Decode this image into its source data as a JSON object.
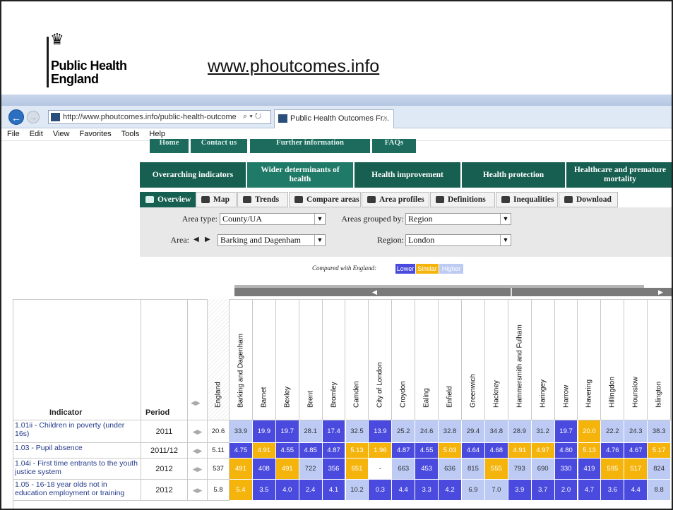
{
  "slide": {
    "org_name": "Public Health England",
    "org_line1": "Public Health",
    "org_line2": "England",
    "link_text": "www.phoutcomes.info"
  },
  "browser": {
    "address": "http://www.phoutcomes.info/public-health-outcome",
    "tab_title": "Public Health Outcomes Fr...",
    "menu": [
      "File",
      "Edit",
      "View",
      "Favorites",
      "Tools",
      "Help"
    ]
  },
  "site": {
    "top_tabs": [
      "Home",
      "Contact us",
      "Further information",
      "FAQs"
    ],
    "domains": [
      "Overarching indicators",
      "Wider determinants of health",
      "Health improvement",
      "Health protection",
      "Healthcare and premature mortality"
    ],
    "active_domain": "Wider determinants of health",
    "views": [
      "Overview",
      "Map",
      "Trends",
      "Compare areas",
      "Area profiles",
      "Definitions",
      "Inequalities",
      "Download"
    ],
    "active_view": "Overview"
  },
  "filters": {
    "area_type_label": "Area type:",
    "area_type_value": "County/UA",
    "grouped_label": "Areas grouped by:",
    "grouped_value": "Region",
    "area_label": "Area:",
    "area_value": "Barking and Dagenham",
    "region_label": "Region:",
    "region_value": "London"
  },
  "legend": {
    "caption": "Compared with England:",
    "lower": "Lower",
    "similar": "Similar",
    "higher": "Higher",
    "colors": {
      "lower": "#4a4adf",
      "similar": "#f5b40c",
      "higher": "#bccaf4"
    }
  },
  "table": {
    "indicator_header": "Indicator",
    "period_header": "Period",
    "england_header": "England",
    "areas": [
      "Barking and Dagenham",
      "Barnet",
      "Bexley",
      "Brent",
      "Bromley",
      "Camden",
      "City of London",
      "Croydon",
      "Ealing",
      "Enfield",
      "Greenwich",
      "Hackney",
      "Hammersmith and Fulham",
      "Haringey",
      "Harrow",
      "Havering",
      "Hillingdon",
      "Hounslow",
      "Islington"
    ],
    "rows": [
      {
        "indicator": "1.01ii - Children in poverty (under 16s)",
        "period": "2011",
        "england": "20.6",
        "values": [
          "33.9",
          "19.9",
          "19.7",
          "28.1",
          "17.4",
          "32.5",
          "13.9",
          "25.2",
          "24.6",
          "32.8",
          "29.4",
          "34.8",
          "28.9",
          "31.2",
          "19.7",
          "20.0",
          "22.2",
          "24.3",
          "38.3"
        ],
        "status": [
          "higher",
          "lower",
          "lower",
          "higher",
          "lower",
          "higher",
          "lower",
          "higher",
          "higher",
          "higher",
          "higher",
          "higher",
          "higher",
          "higher",
          "lower",
          "similar",
          "higher",
          "higher",
          "higher"
        ]
      },
      {
        "indicator": "1.03 - Pupil absence",
        "period": "2011/12",
        "england": "5.11",
        "values": [
          "4.75",
          "4.91",
          "4.55",
          "4.85",
          "4.87",
          "5.13",
          "1.96",
          "4.87",
          "4.55",
          "5.03",
          "4.64",
          "4.68",
          "4.91",
          "4.97",
          "4.80",
          "5.13",
          "4.76",
          "4.67",
          "5.17"
        ],
        "status": [
          "lower",
          "similar",
          "lower",
          "lower",
          "lower",
          "similar",
          "similar",
          "lower",
          "lower",
          "similar",
          "lower",
          "lower",
          "similar",
          "similar",
          "lower",
          "similar",
          "lower",
          "lower",
          "similar"
        ]
      },
      {
        "indicator": "1.04i - First time entrants to the youth justice system",
        "period": "2012",
        "england": "537",
        "values": [
          "491",
          "408",
          "491",
          "722",
          "356",
          "651",
          "-",
          "663",
          "453",
          "636",
          "815",
          "555",
          "793",
          "690",
          "330",
          "419",
          "595",
          "517",
          "824"
        ],
        "status": [
          "similar",
          "lower",
          "similar",
          "higher",
          "lower",
          "similar",
          "none",
          "higher",
          "lower",
          "higher",
          "higher",
          "similar",
          "higher",
          "higher",
          "lower",
          "lower",
          "similar",
          "similar",
          "higher"
        ]
      },
      {
        "indicator": "1.05 - 16-18 year olds not in education employment or training",
        "period": "2012",
        "england": "5.8",
        "values": [
          "5.4",
          "3.5",
          "4.0",
          "2.4",
          "4.1",
          "10.2",
          "0.3",
          "4.4",
          "3.3",
          "4.2",
          "6.9",
          "7.0",
          "3.9",
          "3.7",
          "2.0",
          "4.7",
          "3.6",
          "4.4",
          "8.8"
        ],
        "status": [
          "similar",
          "lower",
          "lower",
          "lower",
          "lower",
          "higher",
          "lower",
          "lower",
          "lower",
          "lower",
          "higher",
          "higher",
          "lower",
          "lower",
          "lower",
          "lower",
          "lower",
          "lower",
          "higher"
        ]
      }
    ]
  }
}
